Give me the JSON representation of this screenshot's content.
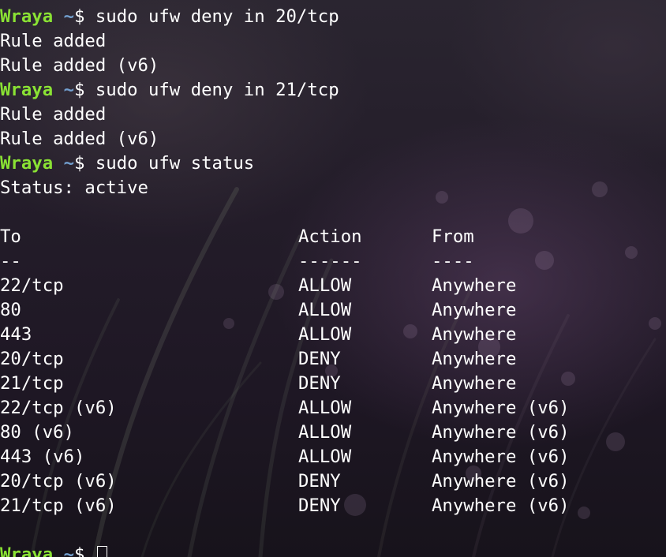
{
  "prompt": {
    "user": "Wraya",
    "path": "~",
    "symbol": "$"
  },
  "session": [
    {
      "command": "sudo ufw deny in 20/tcp",
      "output": [
        "Rule added",
        "Rule added (v6)"
      ]
    },
    {
      "command": "sudo ufw deny in 21/tcp",
      "output": [
        "Rule added",
        "Rule added (v6)"
      ]
    },
    {
      "command": "sudo ufw status",
      "output": [
        "Status: active"
      ]
    }
  ],
  "table": {
    "headers": [
      "To",
      "Action",
      "From"
    ],
    "separators": [
      "--",
      "------",
      "----"
    ],
    "rows": [
      [
        "22/tcp",
        "ALLOW",
        "Anywhere"
      ],
      [
        "80",
        "ALLOW",
        "Anywhere"
      ],
      [
        "443",
        "ALLOW",
        "Anywhere"
      ],
      [
        "20/tcp",
        "DENY",
        "Anywhere"
      ],
      [
        "21/tcp",
        "DENY",
        "Anywhere"
      ],
      [
        "22/tcp (v6)",
        "ALLOW",
        "Anywhere (v6)"
      ],
      [
        "80 (v6)",
        "ALLOW",
        "Anywhere (v6)"
      ],
      [
        "443 (v6)",
        "ALLOW",
        "Anywhere (v6)"
      ],
      [
        "20/tcp (v6)",
        "DENY",
        "Anywhere (v6)"
      ],
      [
        "21/tcp (v6)",
        "DENY",
        "Anywhere (v6)"
      ]
    ]
  },
  "colors": {
    "user": "#8ae234",
    "path": "#729fcf",
    "text": "#ffffff"
  }
}
